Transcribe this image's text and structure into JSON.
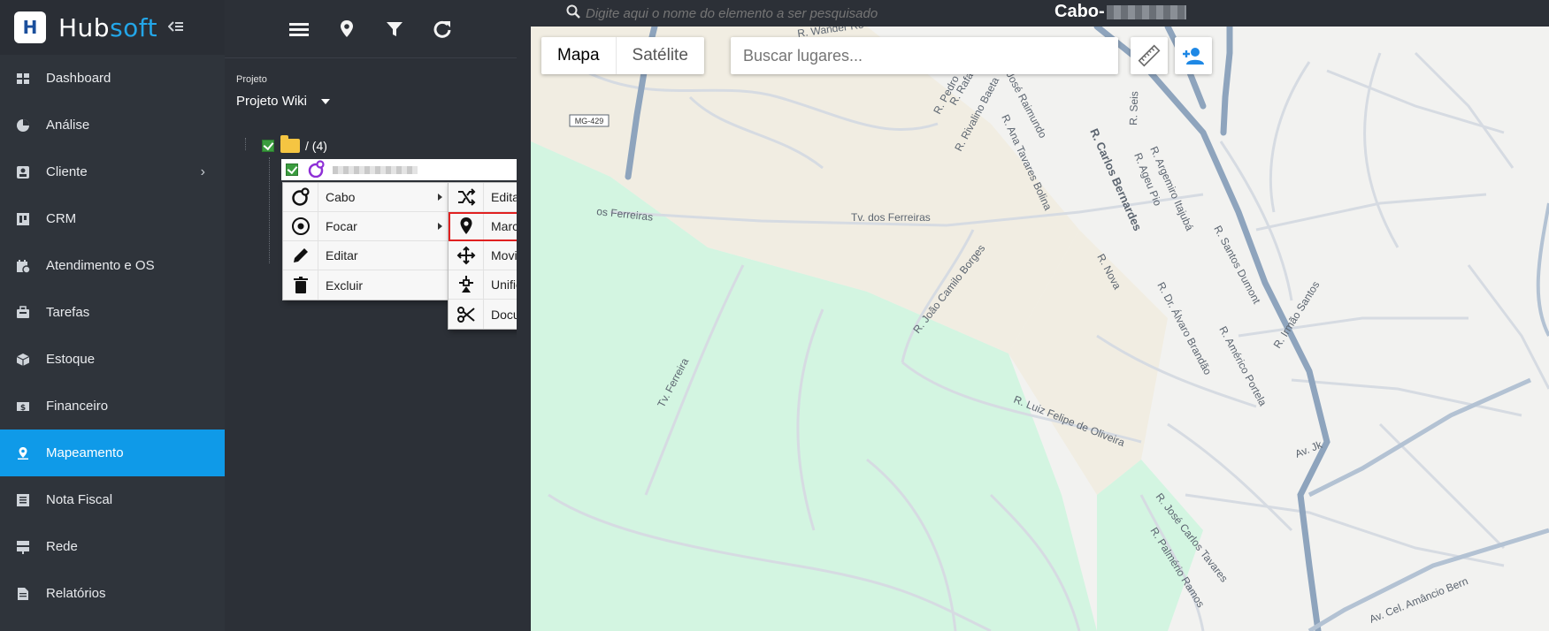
{
  "brand": {
    "name_a": "Hub",
    "name_b": "soft",
    "logo_letter": "H",
    "accent": "#23a6e8"
  },
  "sidebar": {
    "items": [
      {
        "label": "Dashboard",
        "icon": "dashboard-icon"
      },
      {
        "label": "Análise",
        "icon": "pie-chart-icon"
      },
      {
        "label": "Cliente",
        "icon": "contact-card-icon",
        "submenu": true
      },
      {
        "label": "CRM",
        "icon": "board-icon"
      },
      {
        "label": "Atendimento e OS",
        "icon": "calendar-icon"
      },
      {
        "label": "Tarefas",
        "icon": "briefcase-icon"
      },
      {
        "label": "Estoque",
        "icon": "box-icon"
      },
      {
        "label": "Financeiro",
        "icon": "money-icon"
      },
      {
        "label": "Mapeamento",
        "icon": "map-pin-icon",
        "active": true
      },
      {
        "label": "Nota Fiscal",
        "icon": "invoice-icon"
      },
      {
        "label": "Rede",
        "icon": "server-icon"
      },
      {
        "label": "Relatórios",
        "icon": "report-icon"
      }
    ],
    "active_color": "#0f9ae8"
  },
  "tree": {
    "project_label": "Projeto",
    "project_value": "Projeto Wiki",
    "root_label": "/ (4)"
  },
  "context_menu": {
    "items": [
      {
        "label": "Cabo",
        "icon": "cable-icon"
      },
      {
        "label": "Focar",
        "icon": "focus-target-icon"
      },
      {
        "label": "Editar",
        "icon": "pencil-icon"
      },
      {
        "label": "Excluir",
        "icon": "trash-icon"
      }
    ]
  },
  "submenu": {
    "items": [
      {
        "label": "Editar Trajeto",
        "icon": "shuffle-icon"
      },
      {
        "label": "Marcar Pontos de Junção",
        "icon": "map-marker-icon",
        "highlighted": true
      },
      {
        "label": "Movimentar",
        "icon": "move-arrows-icon"
      },
      {
        "label": "Unificar Cabo",
        "icon": "merge-icon"
      },
      {
        "label": "Documentar Rompimento",
        "icon": "scissors-icon"
      }
    ],
    "highlight_color": "#e02020"
  },
  "map": {
    "search_placeholder": "Digite aqui o nome do elemento a ser pesquisado",
    "title_prefix": "Cabo-",
    "map_type": {
      "map_label": "Mapa",
      "satellite_label": "Satélite",
      "selected": "Mapa"
    },
    "places_placeholder": "Buscar lugares...",
    "road_shield": "MG-429",
    "streets": [
      "R. Wander Ro",
      "R. Pedro",
      "R. Rafa",
      "R. Rivalino Baeta",
      "R. José Raimundo",
      "R. Ana Tavares Bolina",
      "R. Carlos Bernardes",
      "R. Ageu Pio",
      "R. Seis",
      "R. Argemiro Itajubá",
      "R. Santos Dumont",
      "R. Nova",
      "R. Dr. Álvaro Brandão",
      "R. Américo Portela",
      "R. Irmão Santos",
      "Tv. dos Ferreiras",
      "os Ferreiras",
      "R. João Camilo Borges",
      "Tv. Ferreira",
      "R. Luiz Felipe de Oliveira",
      "Av. Jk",
      "R. José Carlos Tavares",
      "R. Palmério Ramos",
      "Av. Cel. Amâncio Bern"
    ]
  }
}
